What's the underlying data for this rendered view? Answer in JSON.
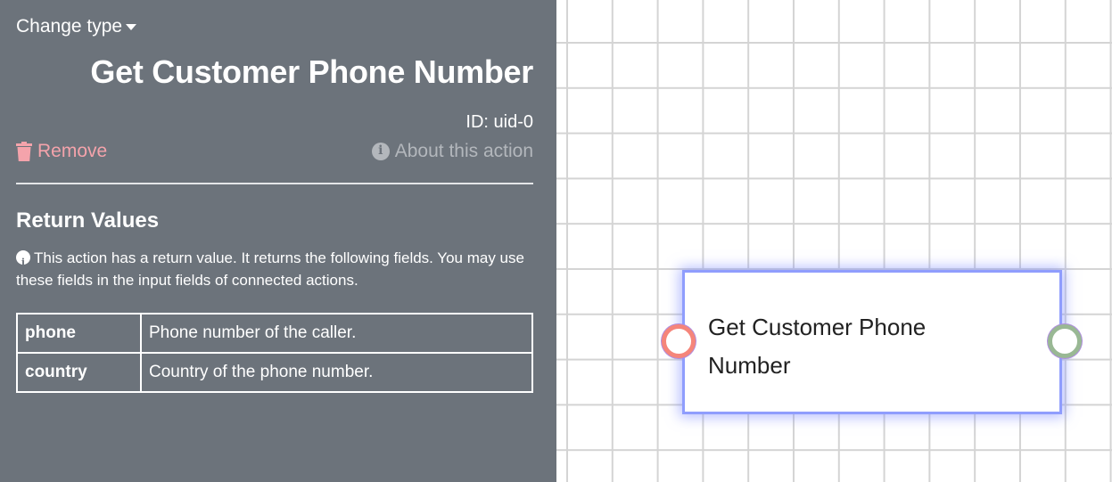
{
  "panel": {
    "change_type": "Change type",
    "title": "Get Customer Phone Number",
    "id": "ID: uid-0",
    "remove": "Remove",
    "about": "About this action",
    "return_heading": "Return Values",
    "return_desc": "This action has a return value. It returns the following fields. You may use these fields in the input fields of connected actions.",
    "fields": [
      {
        "name": "phone",
        "desc": "Phone number of the caller."
      },
      {
        "name": "country",
        "desc": "Country of the phone number."
      }
    ]
  },
  "canvas": {
    "node_label": "Get Customer Phone Number"
  },
  "colors": {
    "panel": "#6c737b",
    "remove": "#f4a3ab",
    "node_border": "#8f9dfd",
    "port_in": "#f5857a",
    "port_out": "#99b894"
  }
}
